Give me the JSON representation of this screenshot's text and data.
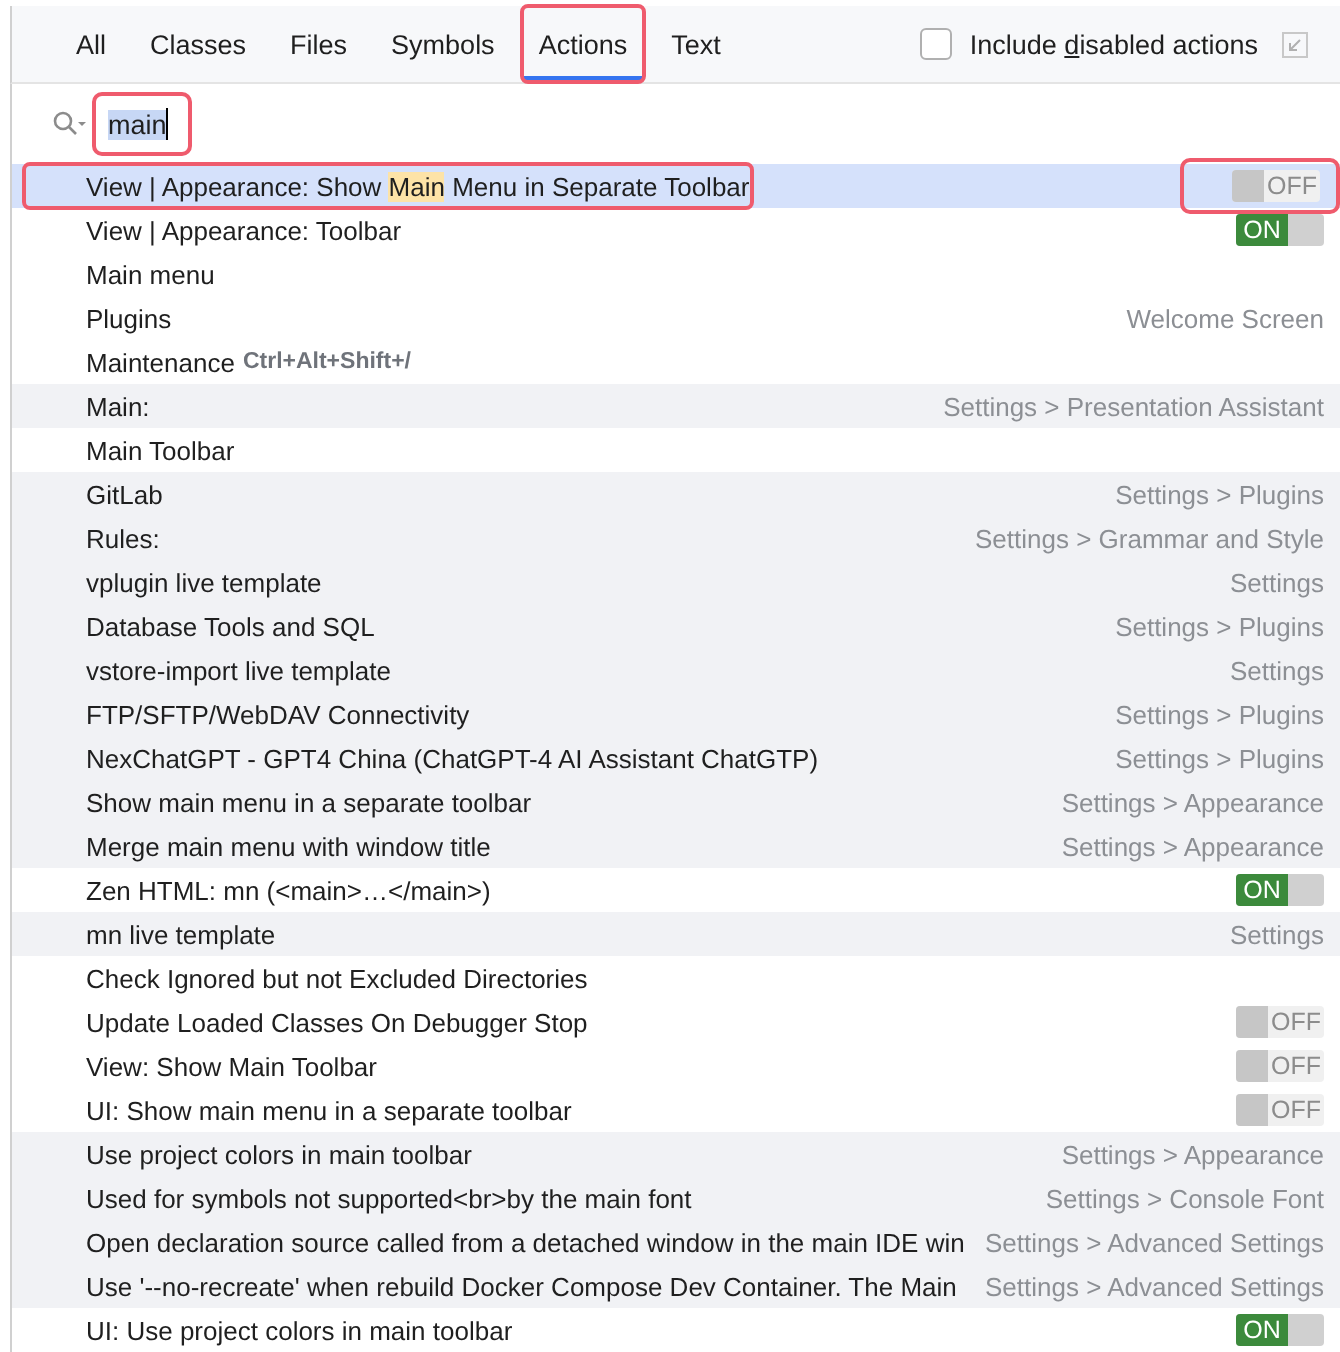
{
  "tabs": [
    {
      "label": "All",
      "selected": false,
      "annotated": false
    },
    {
      "label": "Classes",
      "selected": false,
      "annotated": false
    },
    {
      "label": "Files",
      "selected": false,
      "annotated": false
    },
    {
      "label": "Symbols",
      "selected": false,
      "annotated": false
    },
    {
      "label": "Actions",
      "selected": true,
      "annotated": true
    },
    {
      "label": "Text",
      "selected": false,
      "annotated": false
    }
  ],
  "include_disabled": {
    "label_before": "Include ",
    "mnemonic": "d",
    "label_after": "isabled actions",
    "checked": false
  },
  "search": {
    "value": "main",
    "annotated": true
  },
  "results": [
    {
      "segments": [
        {
          "text": "View | Appearance: Show ",
          "highlighted": false
        },
        {
          "text": "Main",
          "highlighted": true
        },
        {
          "text": " Menu in Separate Toolbar",
          "highlighted": false
        }
      ],
      "selected": true,
      "annotated": true,
      "toggle": {
        "on": false,
        "label": "OFF",
        "annotated": true
      }
    },
    {
      "segments": [
        {
          "text": "View | Appearance: Toolbar",
          "highlighted": false
        }
      ],
      "selected": false,
      "shaded": false,
      "annotated": false,
      "toggle": {
        "on": true,
        "label": "ON",
        "annotated": false
      }
    },
    {
      "segments": [
        {
          "text": "Main menu",
          "highlighted": false
        }
      ],
      "selected": false,
      "shaded": false,
      "annotated": false
    },
    {
      "segments": [
        {
          "text": "Plugins",
          "highlighted": false
        }
      ],
      "selected": false,
      "shaded": false,
      "annotated": false,
      "location": "Welcome Screen"
    },
    {
      "segments": [
        {
          "text": "Maintenance",
          "highlighted": false
        }
      ],
      "shortcut": "Ctrl+Alt+Shift+/",
      "selected": false,
      "shaded": false,
      "annotated": false
    },
    {
      "segments": [
        {
          "text": "Main:",
          "highlighted": false
        }
      ],
      "selected": false,
      "shaded": true,
      "annotated": false,
      "location": "Settings > Presentation Assistant"
    },
    {
      "segments": [
        {
          "text": "Main Toolbar",
          "highlighted": false
        }
      ],
      "selected": false,
      "shaded": false,
      "annotated": false
    },
    {
      "segments": [
        {
          "text": "GitLab",
          "highlighted": false
        }
      ],
      "selected": false,
      "shaded": true,
      "annotated": false,
      "location": "Settings > Plugins"
    },
    {
      "segments": [
        {
          "text": "Rules:",
          "highlighted": false
        }
      ],
      "selected": false,
      "shaded": true,
      "annotated": false,
      "location": "Settings > Grammar and Style"
    },
    {
      "segments": [
        {
          "text": "vplugin live template",
          "highlighted": false
        }
      ],
      "selected": false,
      "shaded": true,
      "annotated": false,
      "location": "Settings"
    },
    {
      "segments": [
        {
          "text": "Database Tools and SQL",
          "highlighted": false
        }
      ],
      "selected": false,
      "shaded": true,
      "annotated": false,
      "location": "Settings > Plugins"
    },
    {
      "segments": [
        {
          "text": "vstore-import live template",
          "highlighted": false
        }
      ],
      "selected": false,
      "shaded": true,
      "annotated": false,
      "location": "Settings"
    },
    {
      "segments": [
        {
          "text": "FTP/SFTP/WebDAV Connectivity",
          "highlighted": false
        }
      ],
      "selected": false,
      "shaded": true,
      "annotated": false,
      "location": "Settings > Plugins"
    },
    {
      "segments": [
        {
          "text": "NexChatGPT - GPT4 China (ChatGPT-4 AI Assistant ChatGTP)",
          "highlighted": false
        }
      ],
      "selected": false,
      "shaded": true,
      "annotated": false,
      "location": "Settings > Plugins"
    },
    {
      "segments": [
        {
          "text": "Show main menu in a separate toolbar",
          "highlighted": false
        }
      ],
      "selected": false,
      "shaded": true,
      "annotated": false,
      "location": "Settings > Appearance"
    },
    {
      "segments": [
        {
          "text": "Merge main menu with window title",
          "highlighted": false
        }
      ],
      "selected": false,
      "shaded": true,
      "annotated": false,
      "location": "Settings > Appearance"
    },
    {
      "segments": [
        {
          "text": "Zen HTML: mn (<main>…</main>)",
          "highlighted": false
        }
      ],
      "selected": false,
      "shaded": false,
      "annotated": false,
      "toggle": {
        "on": true,
        "label": "ON",
        "annotated": false
      }
    },
    {
      "segments": [
        {
          "text": "mn live template",
          "highlighted": false
        }
      ],
      "selected": false,
      "shaded": true,
      "annotated": false,
      "location": "Settings"
    },
    {
      "segments": [
        {
          "text": "Check Ignored but not Excluded Directories",
          "highlighted": false
        }
      ],
      "selected": false,
      "shaded": false,
      "annotated": false
    },
    {
      "segments": [
        {
          "text": "Update Loaded Classes On Debugger Stop",
          "highlighted": false
        }
      ],
      "selected": false,
      "shaded": false,
      "annotated": false,
      "toggle": {
        "on": false,
        "label": "OFF",
        "annotated": false
      }
    },
    {
      "segments": [
        {
          "text": "View: Show Main Toolbar",
          "highlighted": false
        }
      ],
      "selected": false,
      "shaded": false,
      "annotated": false,
      "toggle": {
        "on": false,
        "label": "OFF",
        "annotated": false
      }
    },
    {
      "segments": [
        {
          "text": "UI: Show main menu in a separate toolbar",
          "highlighted": false
        }
      ],
      "selected": false,
      "shaded": false,
      "annotated": false,
      "toggle": {
        "on": false,
        "label": "OFF",
        "annotated": false
      }
    },
    {
      "segments": [
        {
          "text": "Use project colors in main toolbar",
          "highlighted": false
        }
      ],
      "selected": false,
      "shaded": true,
      "annotated": false,
      "location": "Settings > Appearance"
    },
    {
      "segments": [
        {
          "text": "Used for symbols not supported<br>by the main font",
          "highlighted": false
        }
      ],
      "selected": false,
      "shaded": true,
      "annotated": false,
      "location": "Settings > Console Font"
    },
    {
      "segments": [
        {
          "text": "Open declaration source called from a detached window in the main IDE win",
          "highlighted": false
        }
      ],
      "selected": false,
      "shaded": true,
      "annotated": false,
      "location": "Settings > Advanced Settings"
    },
    {
      "segments": [
        {
          "text": "Use '--no-recreate' when rebuild Docker Compose Dev Container. The Main",
          "highlighted": false
        }
      ],
      "selected": false,
      "shaded": true,
      "annotated": false,
      "location": "Settings > Advanced Settings"
    },
    {
      "segments": [
        {
          "text": "UI: Use project colors in main toolbar",
          "highlighted": false
        }
      ],
      "selected": false,
      "shaded": false,
      "annotated": false,
      "toggle": {
        "on": true,
        "label": "ON",
        "annotated": false
      }
    }
  ]
}
